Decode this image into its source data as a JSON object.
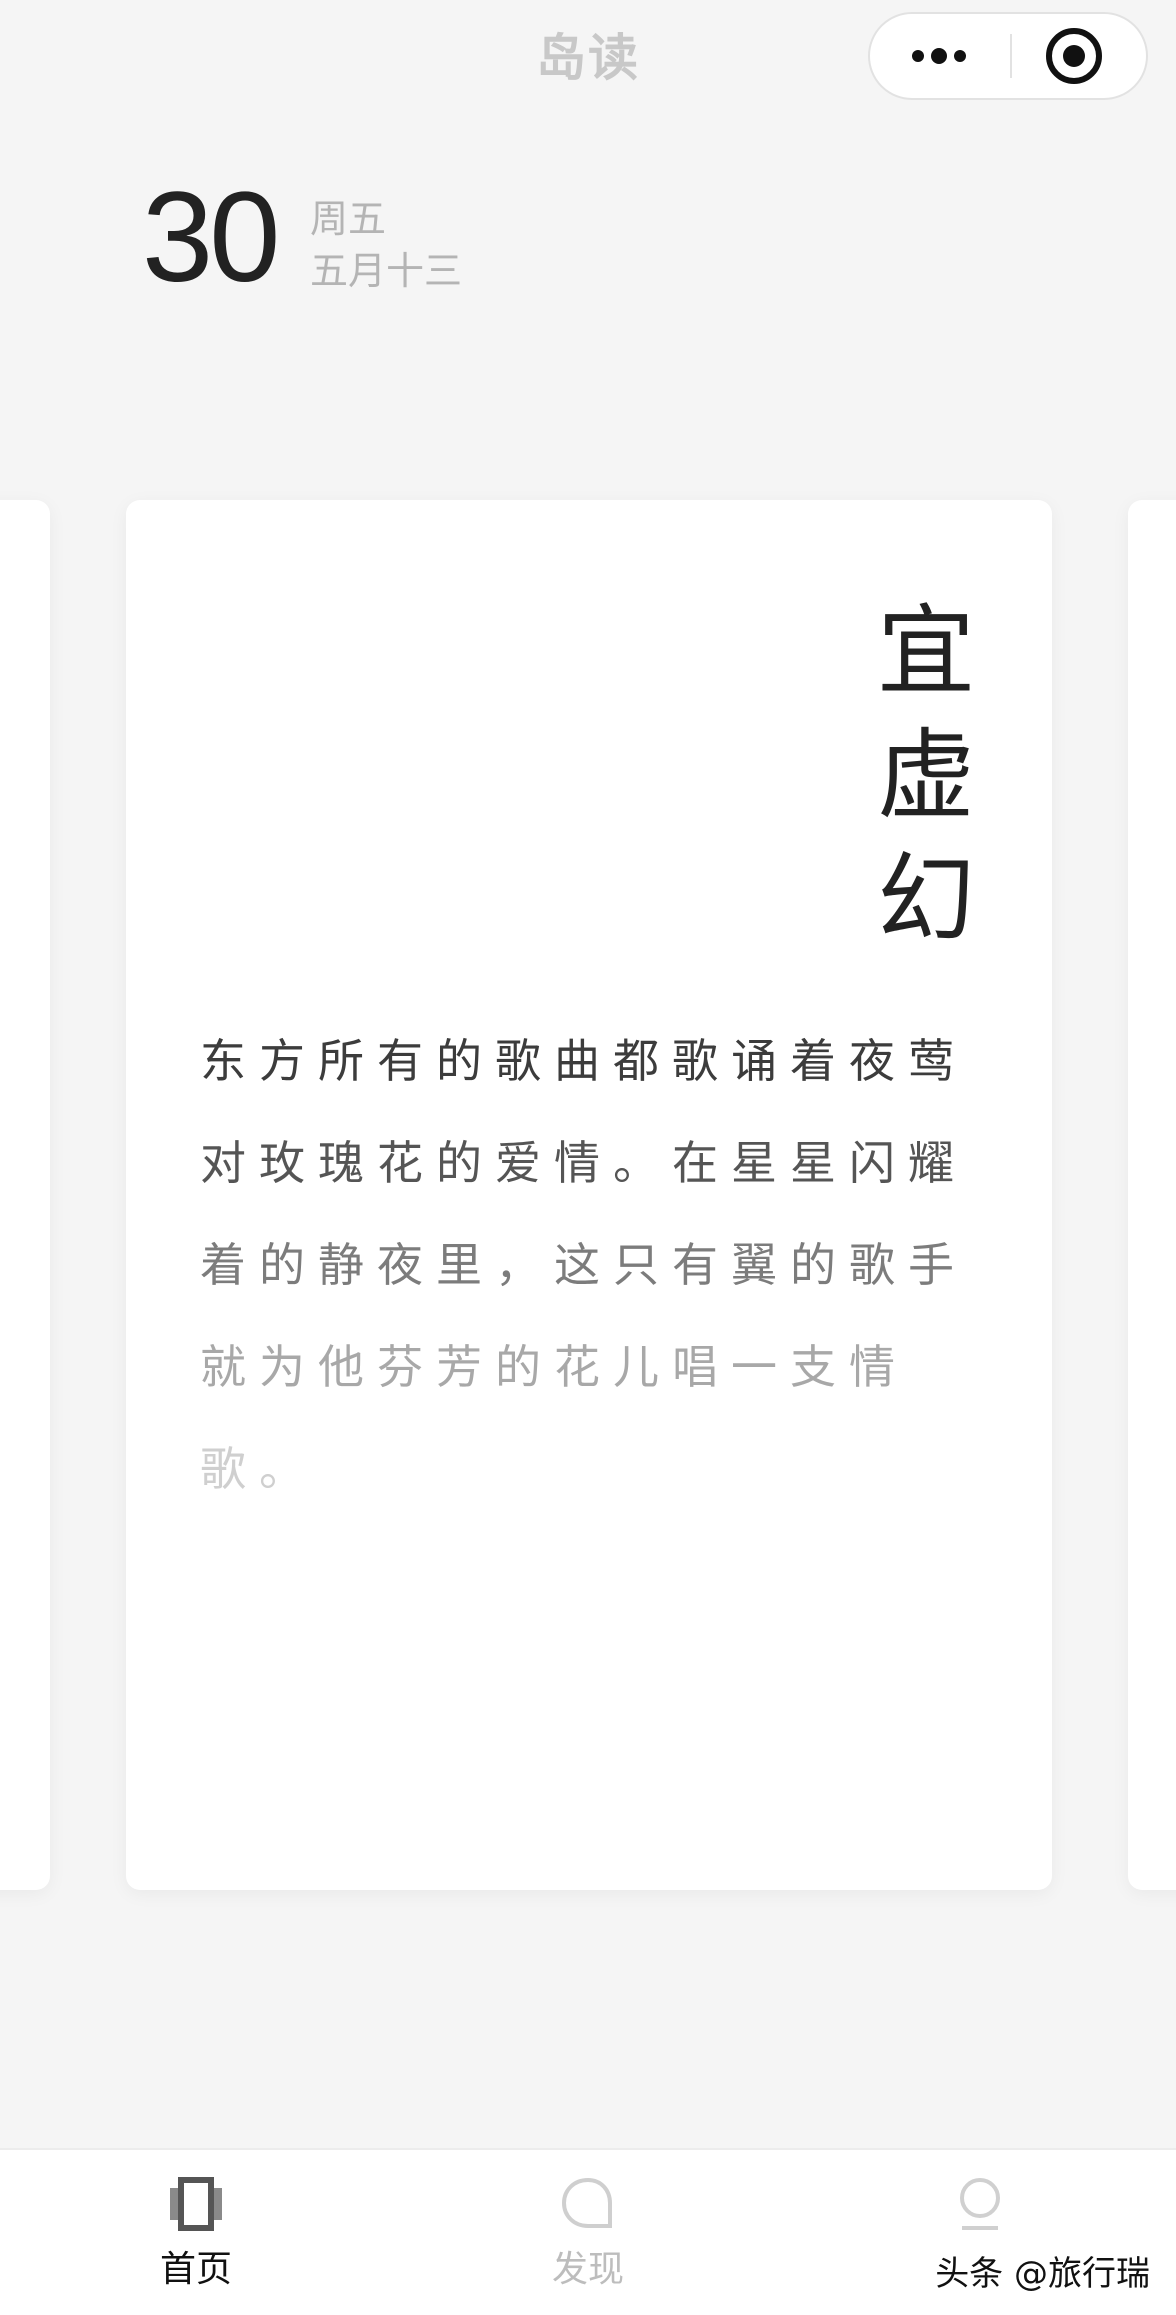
{
  "navbar": {
    "title": "岛读"
  },
  "date": {
    "day": "30",
    "weekday": "周五",
    "lunar": "五月十三"
  },
  "card": {
    "keyword_chars": [
      "宜",
      "虚",
      "幻"
    ],
    "quote_lines": [
      "东方所有的歌曲都歌诵着夜莺",
      "对玫瑰花的爱情。在星星闪耀",
      "着的静夜里，这只有翼的歌手",
      "就为他芬芳的花儿唱一支情",
      "歌。"
    ]
  },
  "tabs": [
    {
      "label": "首页",
      "icon": "home-icon",
      "active": true
    },
    {
      "label": "发现",
      "icon": "discover-icon",
      "active": false
    },
    {
      "label": "",
      "icon": "profile-icon",
      "active": false
    }
  ],
  "watermark": "头条 @旅行瑞",
  "colors": {
    "background": "#f5f5f5",
    "card": "#ffffff",
    "text_primary": "#222222",
    "text_muted": "#b4b4b4",
    "active_tab": "#111111",
    "inactive_tab": "#bdbdbd"
  }
}
